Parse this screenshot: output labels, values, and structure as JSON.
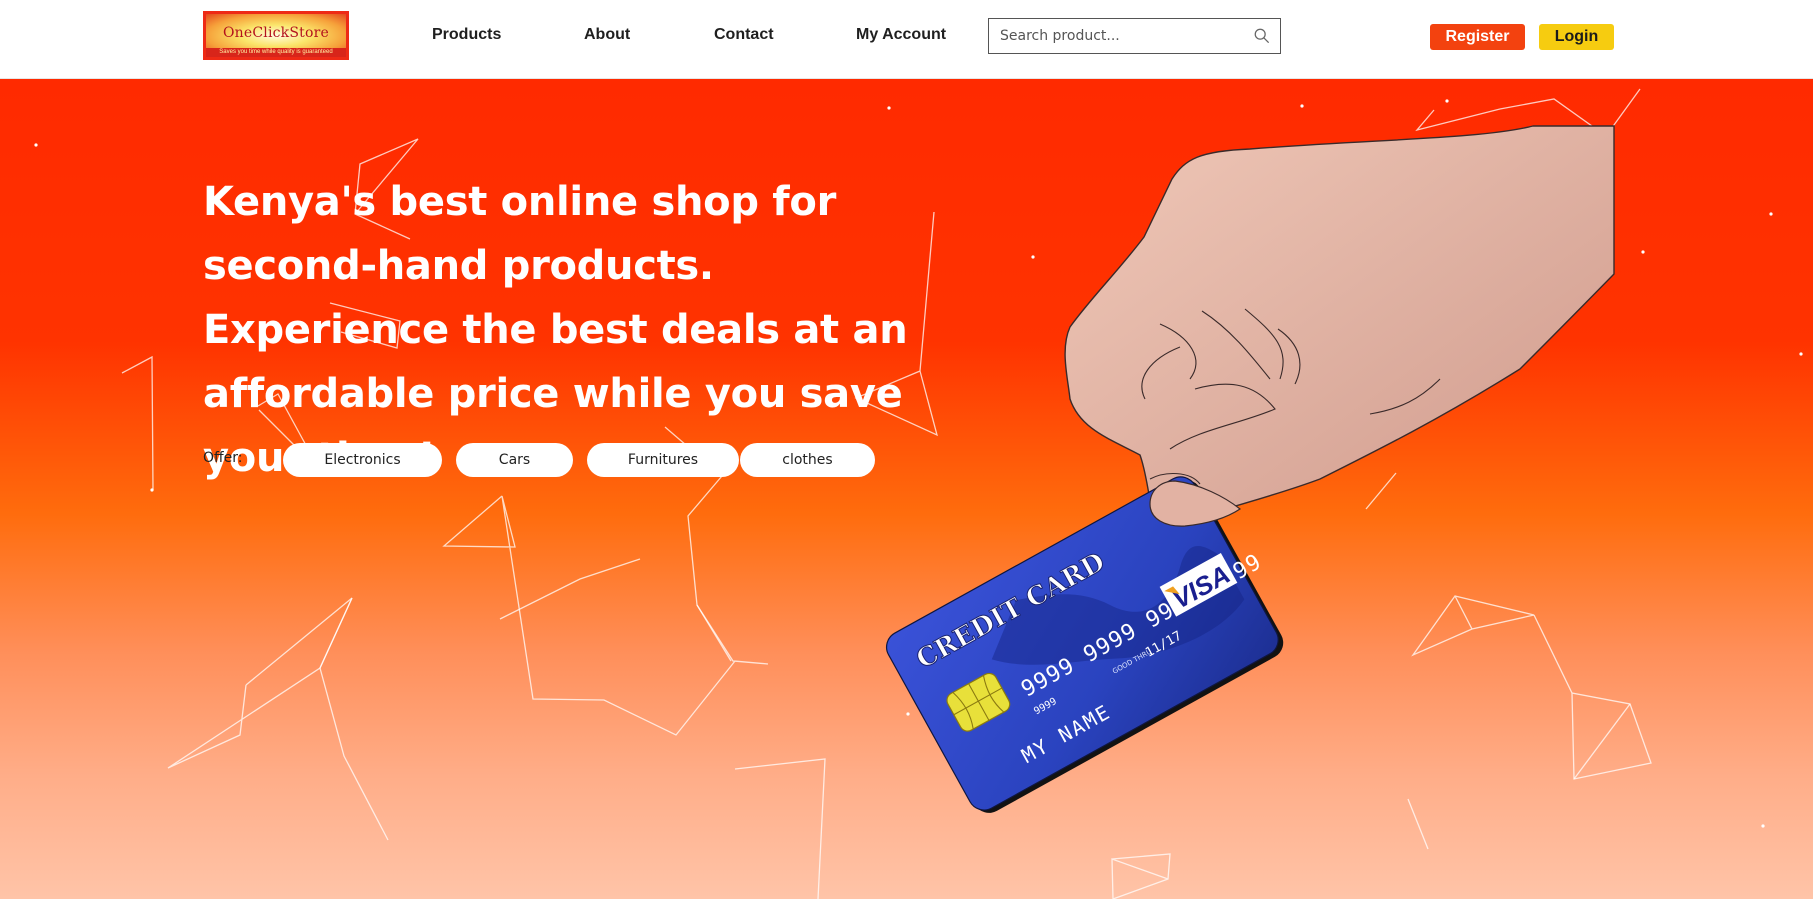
{
  "header": {
    "logo": {
      "name": "OneClickStore",
      "tagline": "Saves you time while quality is guaranteed"
    },
    "nav": [
      {
        "label": "Products"
      },
      {
        "label": "About"
      },
      {
        "label": "Contact"
      },
      {
        "label": "My Account"
      }
    ],
    "search": {
      "placeholder": "Search product...",
      "value": "",
      "icon": "search-icon"
    },
    "register_label": "Register",
    "login_label": "Login"
  },
  "hero": {
    "headline": "Kenya's best online shop for second-hand products. Experience the best deals at an affordable price while you save your time!",
    "offer_label": "Offer:",
    "offers": [
      {
        "label": "Electronics"
      },
      {
        "label": "Cars"
      },
      {
        "label": "Furnitures"
      },
      {
        "label": "clothes"
      }
    ],
    "illustration": {
      "card_title": "CREDIT CARD",
      "card_number": "9999 9999 9999 9999",
      "card_small_number": "9999",
      "valid_label": "GOOD THRU",
      "expiry": "11/17",
      "card_holder": "MY NAME",
      "card_brand": "VISA"
    }
  },
  "colors": {
    "brand_red": "#ff2a00",
    "register_button": "#f3420f",
    "login_button": "#f6cc10",
    "card_blue": "#2c3fb8"
  }
}
